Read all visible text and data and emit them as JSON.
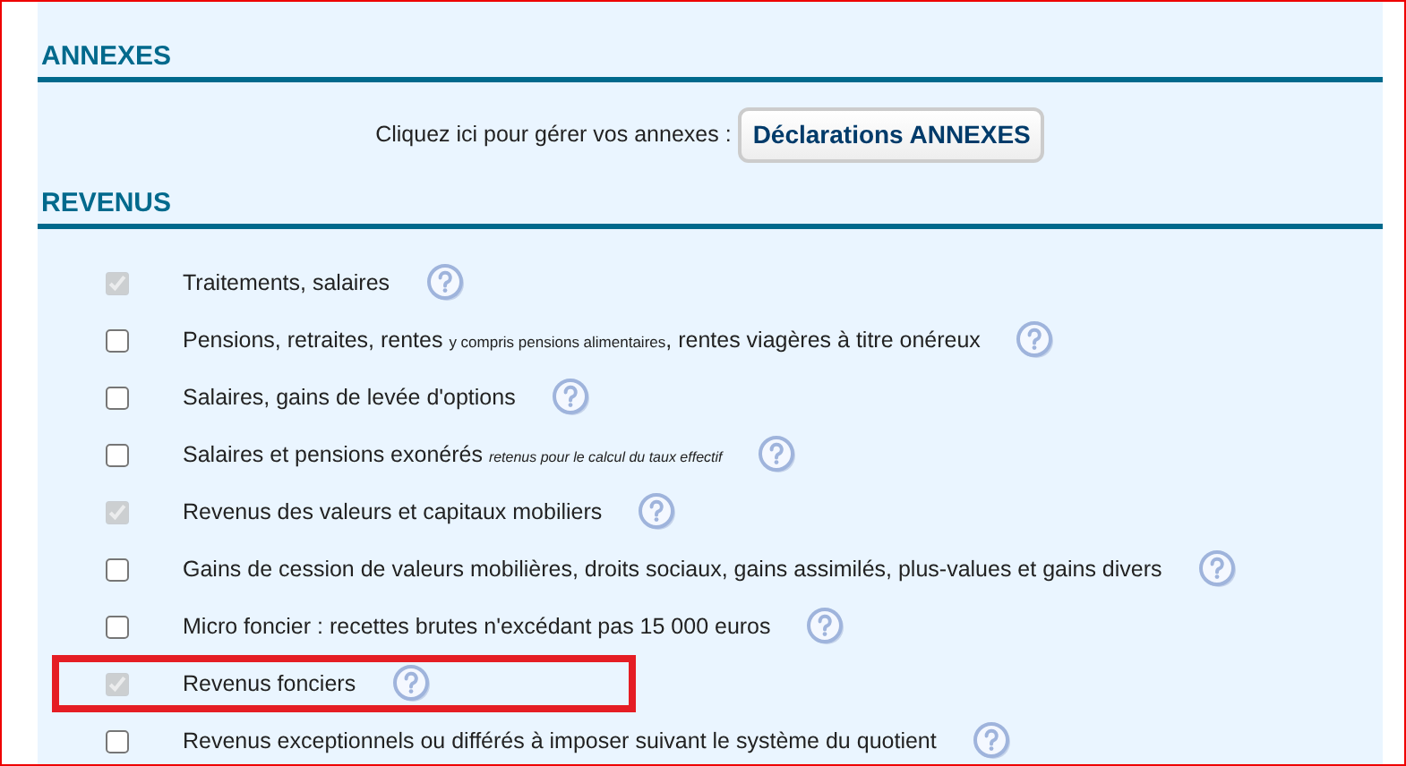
{
  "sections": [
    {
      "title": "ANNEXES",
      "kind": "annexes",
      "prompt": "Cliquez ici pour gérer vos annexes :",
      "button": "Déclarations ANNEXES"
    },
    {
      "title": "REVENUS",
      "kind": "revenus",
      "items": [
        {
          "parts": [
            {
              "text": "Traitements, salaires",
              "kind": "normal"
            }
          ],
          "checked": true,
          "disabled": true,
          "highlighted": false
        },
        {
          "parts": [
            {
              "text": "Pensions, retraites, rentes ",
              "kind": "normal"
            },
            {
              "text": "y compris pensions alimentaires",
              "kind": "small"
            },
            {
              "text": ", rentes viagères à titre onéreux",
              "kind": "normal"
            }
          ],
          "checked": false,
          "disabled": false,
          "highlighted": false
        },
        {
          "parts": [
            {
              "text": "Salaires, gains de levée d'options",
              "kind": "normal"
            }
          ],
          "checked": false,
          "disabled": false,
          "highlighted": false
        },
        {
          "parts": [
            {
              "text": "Salaires et pensions exonérés ",
              "kind": "normal"
            },
            {
              "text": "retenus pour le calcul du taux effectif",
              "kind": "note"
            }
          ],
          "checked": false,
          "disabled": false,
          "highlighted": false
        },
        {
          "parts": [
            {
              "text": "Revenus des valeurs et capitaux mobiliers",
              "kind": "normal"
            }
          ],
          "checked": true,
          "disabled": true,
          "highlighted": false
        },
        {
          "parts": [
            {
              "text": "Gains de cession de valeurs mobilières, droits sociaux, gains assimilés, plus-values et gains divers",
              "kind": "normal"
            }
          ],
          "checked": false,
          "disabled": false,
          "highlighted": false
        },
        {
          "parts": [
            {
              "text": "Micro foncier : recettes brutes n'excédant pas 15 000 euros",
              "kind": "normal"
            }
          ],
          "checked": false,
          "disabled": false,
          "highlighted": false
        },
        {
          "parts": [
            {
              "text": "Revenus fonciers",
              "kind": "normal"
            }
          ],
          "checked": true,
          "disabled": true,
          "highlighted": true
        },
        {
          "parts": [
            {
              "text": "Revenus exceptionnels ou différés à imposer suivant le système du quotient",
              "kind": "normal"
            }
          ],
          "checked": false,
          "disabled": false,
          "highlighted": false
        }
      ]
    }
  ]
}
